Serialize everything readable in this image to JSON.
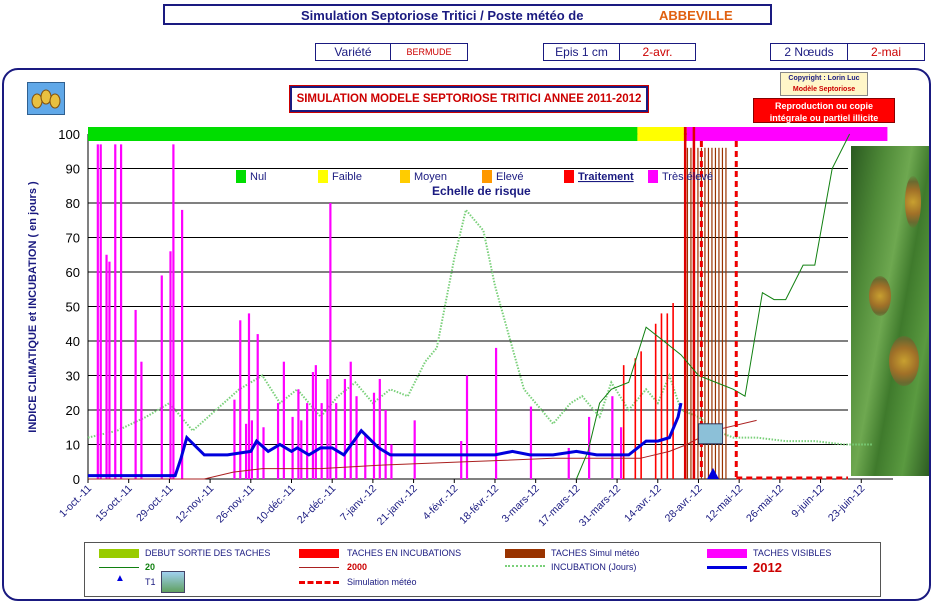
{
  "header": {
    "title": "Simulation Septoriose Tritici / Poste météo de",
    "station": "ABBEVILLE",
    "variete_label": "Variété",
    "variete_value": "BERMUDE",
    "epis_label": "Epis 1 cm",
    "epis_date": "2-avr.",
    "noeuds_label": "2 Nœuds",
    "noeuds_date": "2-mai"
  },
  "badges": {
    "copyright_line1": "Copyright : Lorin Luc",
    "copyright_line2": "Modèle Septoriose",
    "reproduction_line1": "Reproduction ou copie",
    "reproduction_line2": "intégrale ou partiel illicite"
  },
  "risk_legend": {
    "items": [
      {
        "label": "Nul",
        "color": "#00dd00"
      },
      {
        "label": "Faible",
        "color": "#ffff00"
      },
      {
        "label": "Moyen",
        "color": "#ffcc00"
      },
      {
        "label": "Elevé",
        "color": "#ff9900"
      },
      {
        "label": "Traitement",
        "color": "#ff0000"
      },
      {
        "label": "Très élevé",
        "color": "#ff00ff"
      }
    ],
    "scale_title": "Echelle de risque"
  },
  "legend": {
    "debut_sortie": "DEBUT SORTIE DES TACHES",
    "taches_incubation": "TACHES EN INCUBATIONS",
    "taches_simul": "TACHES Simul météo",
    "taches_visibles": "TACHES VISIBLES",
    "series_green": "20",
    "series_2000": "2000",
    "incubation": "INCUBATION (Jours)",
    "series_2012": "2012",
    "t1": "T1",
    "simulation": "Simulation météo"
  },
  "chart_data": {
    "type": "line",
    "title": "SIMULATION MODELE SEPTORIOSE TRITICI ANNEE 2011-2012",
    "ylabel": "INDICE CLIMATIQUE  et  INCUBATION ( en jours )",
    "ylim": [
      0,
      100
    ],
    "yticks": [
      0,
      10,
      20,
      30,
      40,
      50,
      60,
      70,
      80,
      90,
      100
    ],
    "xticks": [
      "1-oct.-11",
      "15-oct.-11",
      "29-oct.-11",
      "12-nov.-11",
      "26-nov.-11",
      "10-déc.-11",
      "24-déc.-11",
      "7-janv.-12",
      "21-janv.-12",
      "4-févr.-12",
      "18-févr.-12",
      "3-mars-12",
      "17-mars-12",
      "31-mars-12",
      "14-avr.-12",
      "28-avr.-12",
      "12-mai-12",
      "26-mai-12",
      "9-juin-12",
      "23-juin-12"
    ],
    "risk_band": [
      {
        "from": 0,
        "to": 189,
        "level": "Nul"
      },
      {
        "from": 189,
        "to": 205,
        "level": "Faible"
      },
      {
        "from": 205,
        "to": 206,
        "level": "Traitement"
      },
      {
        "from": 206,
        "to": 275,
        "level": "Très élevé"
      }
    ],
    "bars_visible": {
      "day": [
        3,
        4,
        6,
        7,
        9,
        11,
        16,
        18,
        25,
        28,
        29,
        32,
        50,
        52,
        54,
        55,
        56,
        58,
        60,
        65,
        67,
        70,
        72,
        73,
        75,
        77,
        78,
        80,
        82,
        83,
        85,
        88,
        90,
        92,
        95,
        98,
        100,
        102,
        104,
        112,
        128,
        130,
        140,
        152,
        165,
        172,
        180,
        183
      ],
      "value": [
        97,
        97,
        65,
        63,
        97,
        97,
        49,
        34,
        59,
        66,
        97,
        78,
        23,
        46,
        16,
        48,
        17,
        42,
        15,
        22,
        34,
        18,
        26,
        17,
        22,
        31,
        33,
        22,
        29,
        80,
        22,
        29,
        34,
        24,
        13,
        25,
        29,
        20,
        10,
        17,
        11,
        30,
        38,
        21,
        9,
        18,
        24,
        15
      ]
    },
    "bars_incubation": {
      "day": [
        184,
        188,
        190,
        195,
        197,
        199,
        201
      ],
      "value": [
        33,
        35,
        37,
        45,
        48,
        48,
        51
      ]
    },
    "series": [
      {
        "name": "2012",
        "color": "#0000dd",
        "x": [
          0,
          30,
          32,
          34,
          40,
          48,
          56,
          58,
          62,
          66,
          70,
          72,
          76,
          80,
          84,
          88,
          94,
          100,
          104,
          110,
          120,
          130,
          136,
          140,
          146,
          152,
          160,
          168,
          175,
          180,
          186,
          192,
          196,
          200,
          203,
          204
        ],
        "y": [
          1,
          1,
          6,
          12,
          7,
          7,
          8,
          11,
          8,
          10,
          8,
          9,
          7,
          9,
          9,
          7,
          14,
          9,
          7,
          7,
          7,
          7,
          7,
          7,
          8,
          7,
          7,
          8,
          7,
          7,
          7,
          11,
          11,
          12,
          18,
          22
        ]
      },
      {
        "name": "2000",
        "color": "#aa2020",
        "x": [
          0,
          40,
          50,
          60,
          80,
          100,
          130,
          160,
          190,
          200,
          206,
          215,
          230
        ],
        "y": [
          0,
          0,
          2,
          3,
          3,
          4,
          5,
          6,
          6,
          8,
          10,
          14,
          17
        ]
      },
      {
        "name": "INCUBATION (Jours)",
        "color": "#7ad07a",
        "x": [
          0,
          10,
          20,
          28,
          36,
          44,
          52,
          60,
          66,
          72,
          80,
          86,
          92,
          98,
          104,
          110,
          116,
          120,
          126,
          130,
          136,
          140,
          146,
          150,
          156,
          160,
          166,
          170,
          176,
          180,
          186,
          192,
          196,
          200,
          204,
          210,
          216,
          222,
          230,
          240,
          250,
          260,
          270
        ],
        "y": [
          12,
          14,
          18,
          22,
          14,
          20,
          26,
          30,
          22,
          26,
          18,
          24,
          28,
          22,
          26,
          24,
          34,
          38,
          64,
          78,
          72,
          56,
          38,
          26,
          20,
          16,
          22,
          24,
          18,
          28,
          20,
          26,
          22,
          30,
          20,
          18,
          14,
          12,
          12,
          11,
          11,
          10,
          10
        ]
      },
      {
        "name": "20",
        "color": "#108010",
        "x": [
          168,
          172,
          176,
          180,
          186,
          192,
          198,
          204,
          210,
          216,
          222,
          226,
          232,
          236,
          240,
          246,
          250,
          256,
          262
        ],
        "y": [
          0,
          8,
          22,
          26,
          28,
          44,
          40,
          36,
          30,
          28,
          26,
          24,
          54,
          52,
          52,
          62,
          62,
          90,
          110
        ]
      },
      {
        "name": "Simulation météo",
        "color": "#ee0000",
        "x": [
          206,
          220,
          233
        ],
        "y": [
          100,
          100,
          100
        ]
      }
    ]
  }
}
